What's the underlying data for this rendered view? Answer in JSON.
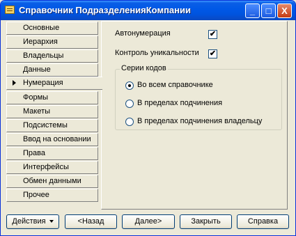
{
  "window": {
    "title": "Справочник ПодразделенияКомпании"
  },
  "title_buttons": {
    "minimize": "_",
    "maximize": "□",
    "close": "X"
  },
  "nav": {
    "items": [
      {
        "label": "Основные"
      },
      {
        "label": "Иерархия"
      },
      {
        "label": "Владельцы"
      },
      {
        "label": "Данные"
      },
      {
        "label": "Нумерация"
      },
      {
        "label": "Формы"
      },
      {
        "label": "Макеты"
      },
      {
        "label": "Подсистемы"
      },
      {
        "label": "Ввод на основании"
      },
      {
        "label": "Права"
      },
      {
        "label": "Интерфейсы"
      },
      {
        "label": "Обмен данными"
      },
      {
        "label": "Прочее"
      }
    ],
    "active": "Нумерация"
  },
  "options": {
    "autonumber_label": "Автонумерация",
    "autonumber_checked": true,
    "uniqueness_label": "Контроль уникальности",
    "uniqueness_checked": true,
    "check_mark": "✔"
  },
  "code_series": {
    "title": "Серии кодов",
    "options": [
      {
        "label": "Во всем справочнике",
        "selected": true
      },
      {
        "label": "В пределах подчинения",
        "selected": false
      },
      {
        "label": "В пределах подчинения владельцу",
        "selected": false
      }
    ]
  },
  "buttons": {
    "actions": "Действия",
    "back": "<Назад",
    "next": "Далее>",
    "close": "Закрыть",
    "help": "Справка"
  }
}
